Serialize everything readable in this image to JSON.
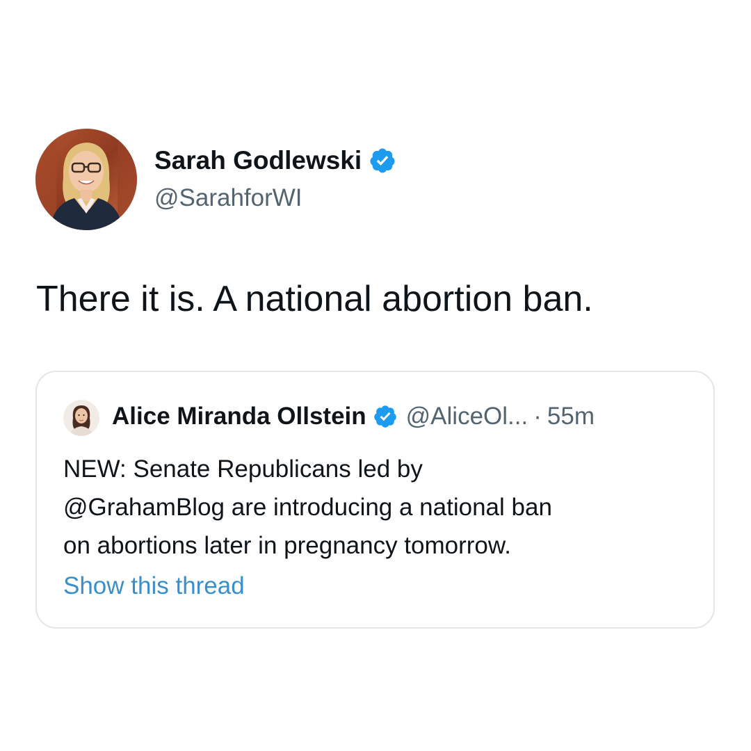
{
  "tweet": {
    "author": {
      "name": "Sarah Godlewski",
      "handle": "@SarahforWI",
      "verified": true,
      "avatar_icon": "profile-photo-avatar"
    },
    "text": "There it is. A national abortion ban.",
    "quoted_tweet": {
      "author": {
        "name": "Alice Miranda Ollstein",
        "handle": "@AliceOl...",
        "verified": true,
        "avatar_icon": "profile-photo-avatar"
      },
      "separator": "·",
      "time": "55m",
      "text_lines": [
        "NEW: Senate Republicans led by",
        "@GrahamBlog are introducing a national ban",
        "on abortions later in pregnancy tomorrow."
      ],
      "show_thread_label": "Show this thread"
    }
  },
  "colors": {
    "text_primary": "#0f1419",
    "text_secondary": "#536471",
    "link": "#3a8fca",
    "verified_badge": "#1d9bf0",
    "card_border": "#e3e6e9"
  }
}
